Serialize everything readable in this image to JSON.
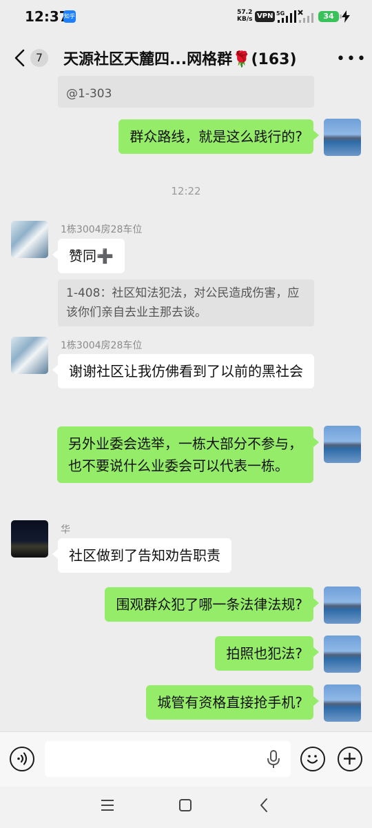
{
  "status_bar": {
    "time": "12:37",
    "app_badge": "知乎",
    "net_speed_value": "57.2",
    "net_speed_unit": "KB/s",
    "vpn": "VPN",
    "sim1_label": "5G",
    "battery": "34"
  },
  "header": {
    "unread_count": "7",
    "title": "天源社区天麓四...网格群🌹(163)"
  },
  "messages": {
    "top_partial_quote": "@1-303",
    "msg1": "群众路线，就是这么践行的?",
    "time1": "12:22",
    "sender2": "1栋3004房28车位",
    "msg2": "赞同➕",
    "quote2": "1-408：社区知法犯法，对公民造成伤害，应该你们亲自去业主那去谈。",
    "sender3": "1栋3004房28车位",
    "msg3": "谢谢社区让我仿佛看到了以前的黑社会",
    "msg4": "另外业委会选举，一栋大部分不参与，也不要说什么业委会可以代表一栋。",
    "sender5": "华",
    "msg5": "社区做到了告知劝告职责",
    "msg6": "围观群众犯了哪一条法律法规?",
    "msg7": "拍照也犯法?",
    "msg8": "城管有资格直接抢手机?"
  },
  "input_bar": {
    "voice_icon": "voice-icon",
    "mic_icon": "microphone-icon",
    "emoji_icon": "emoji-icon",
    "plus_icon": "plus-icon"
  },
  "colors": {
    "outgoing_bubble": "#95ec69",
    "incoming_bubble": "#ffffff",
    "background": "#ededed"
  }
}
